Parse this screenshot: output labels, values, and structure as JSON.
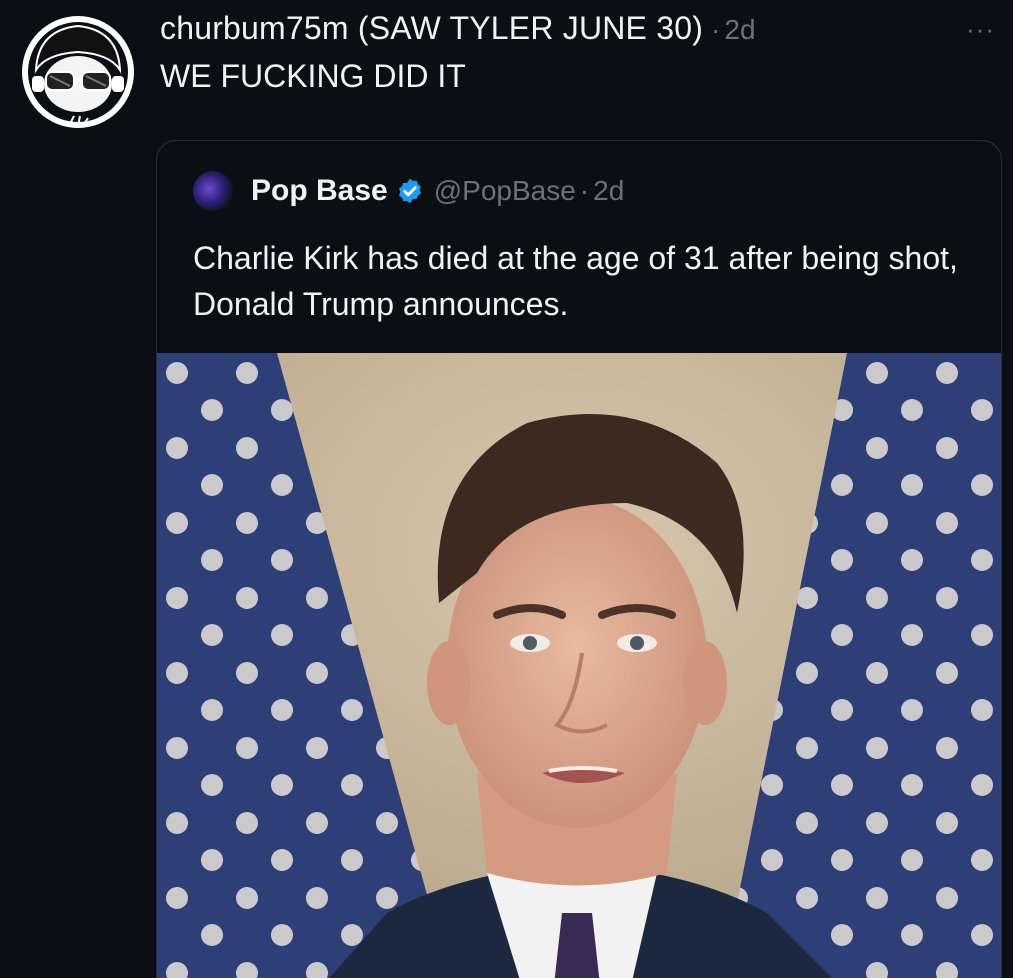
{
  "post": {
    "username": "churbum75m (SAW TYLER JUNE 30)",
    "separator": "·",
    "time": "2d",
    "more_icon": "ellipsis-icon",
    "text": "WE FUCKING DID IT",
    "avatar_icon": "cartoon-avatar"
  },
  "quote": {
    "name": "Pop Base",
    "handle": "@PopBase",
    "separator": "·",
    "time": "2d",
    "verified_icon": "verified-badge-icon",
    "text": "Charlie Kirk has died at the age of 31 after being shot, Donald Trump announces.",
    "media": {
      "kind": "photo",
      "subject": "portrait-in-front-of-flags"
    }
  },
  "colors": {
    "background": "#0b0f14",
    "text": "#f2f2f2",
    "muted": "#6b7178",
    "verified": "#1d9bf0",
    "card_border": "#2a3038"
  }
}
